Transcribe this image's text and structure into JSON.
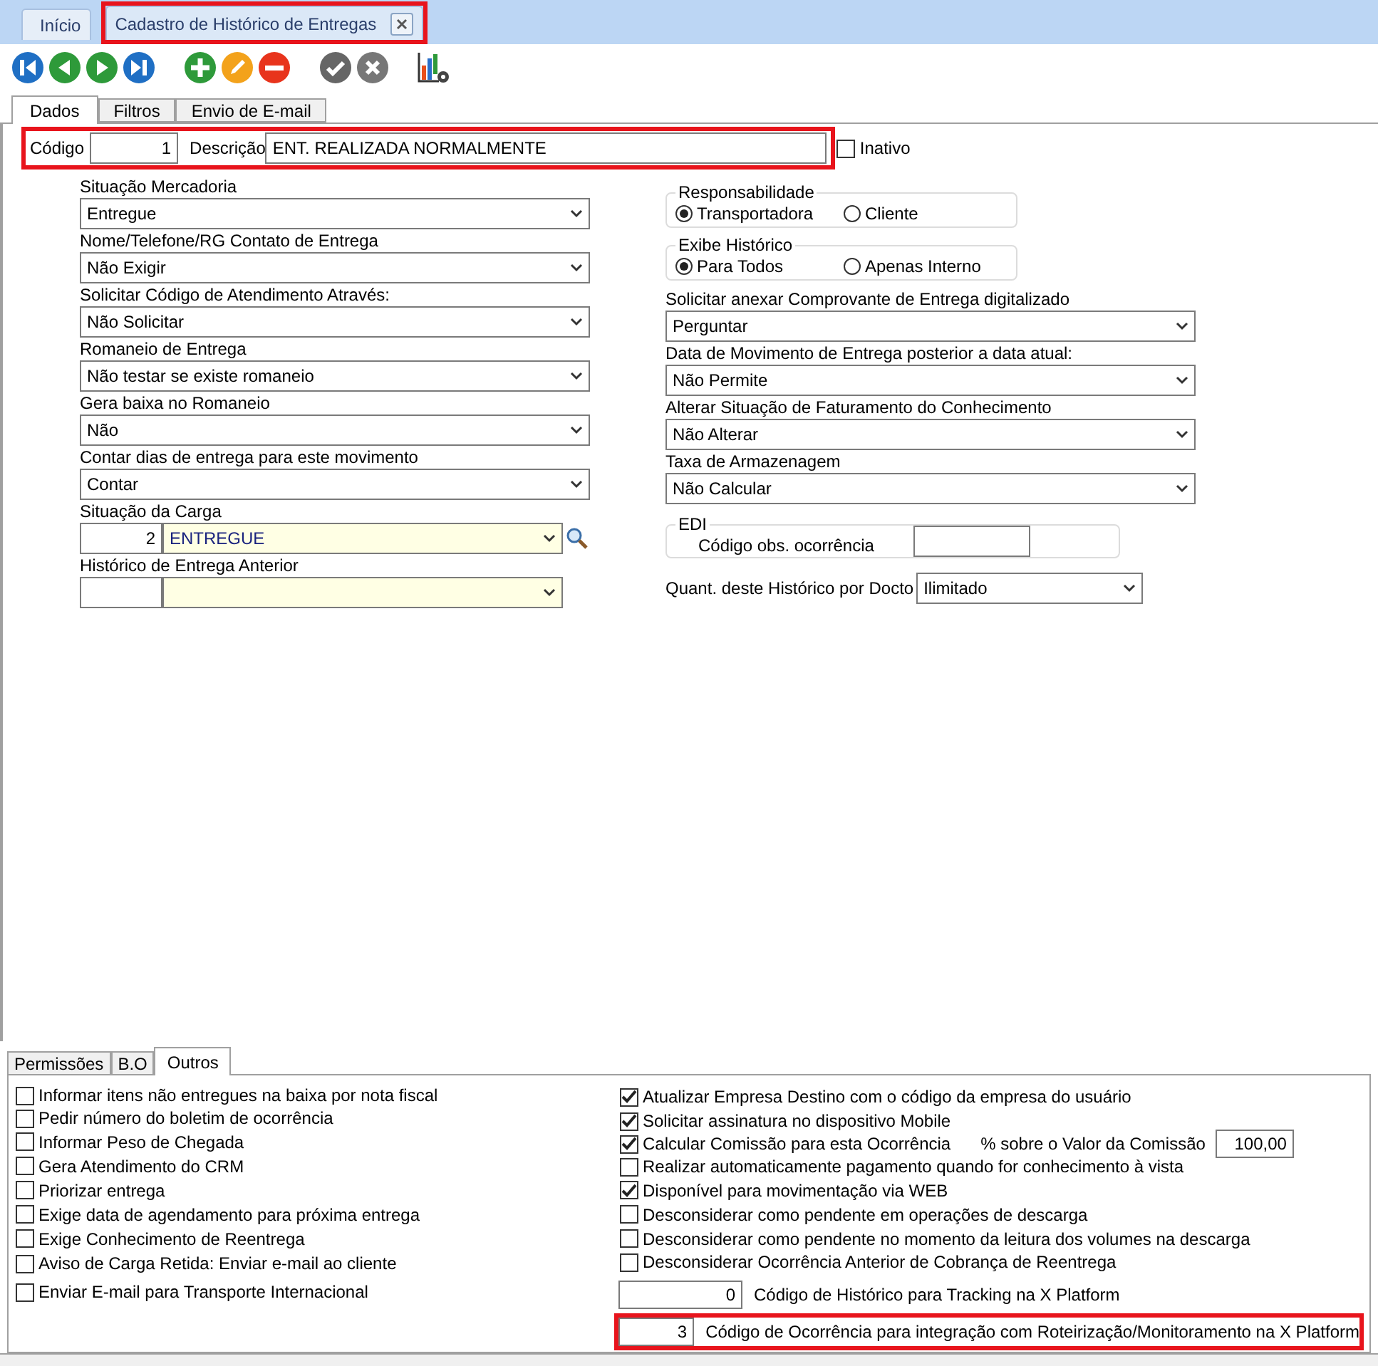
{
  "app_tabs": [
    {
      "label": "Início",
      "selected": false,
      "closable": false,
      "highlighted": false
    },
    {
      "label": "Cadastro de Histórico de Entregas",
      "selected": true,
      "closable": true,
      "highlighted": true
    }
  ],
  "toolbar": [
    {
      "kind": "first"
    },
    {
      "kind": "prev"
    },
    {
      "kind": "next"
    },
    {
      "kind": "last"
    },
    {
      "kind": "add"
    },
    {
      "kind": "edit"
    },
    {
      "kind": "delete"
    },
    {
      "kind": "confirm"
    },
    {
      "kind": "cancel"
    },
    {
      "kind": "report"
    }
  ],
  "form_tabs": [
    {
      "label": "Dados",
      "selected": true
    },
    {
      "label": "Filtros",
      "selected": false
    },
    {
      "label": "Envio de E-mail",
      "selected": false
    }
  ],
  "header": {
    "highlighted": true,
    "code_label": "Código",
    "code": "1",
    "description_label": "Descrição",
    "description": "ENT. REALIZADA NORMALMENTE",
    "inactive_label": "Inativo",
    "inactive": false
  },
  "left_fields": [
    {
      "kind": "select",
      "label": "Situação Mercadoria",
      "value": "Entregue"
    },
    {
      "kind": "select",
      "label": "Nome/Telefone/RG Contato de Entrega",
      "value": "Não Exigir"
    },
    {
      "kind": "select",
      "label": "Solicitar Código de Atendimento Através:",
      "value": "Não Solicitar"
    },
    {
      "kind": "select",
      "label": "Romaneio de Entrega",
      "value": "Não testar se existe romaneio"
    },
    {
      "kind": "select",
      "label": "Gera baixa no Romaneio",
      "value": "Não"
    },
    {
      "kind": "select",
      "label": "Contar dias de entrega para este movimento",
      "value": "Contar"
    },
    {
      "kind": "lookup",
      "label": "Situação da Carga",
      "code": "2",
      "value": "ENTREGUE",
      "search": true
    },
    {
      "kind": "lookup",
      "label": "Histórico de Entrega Anterior"
    }
  ],
  "radio_groups": [
    {
      "title": "Responsabilidade",
      "options": [
        {
          "label": "Transportadora",
          "selected": true
        },
        {
          "label": "Cliente",
          "selected": false
        }
      ]
    },
    {
      "title": "Exibe Histórico",
      "options": [
        {
          "label": "Para Todos",
          "selected": true
        },
        {
          "label": "Apenas Interno",
          "selected": false
        }
      ]
    }
  ],
  "right_fields": [
    {
      "label": "Solicitar anexar Comprovante de Entrega digitalizado",
      "value": "Perguntar"
    },
    {
      "label": "Data de Movimento de Entrega posterior a data atual:",
      "value": "Não Permite"
    },
    {
      "label": "Alterar Situação de Faturamento do Conhecimento",
      "value": "Não Alterar"
    },
    {
      "label": "Taxa de Armazenagem",
      "value": "Não Calcular"
    }
  ],
  "edi": {
    "title": "EDI",
    "label": "Código obs. ocorrência"
  },
  "quantity": {
    "label": "Quant. deste Histórico por Docto",
    "value": "Ilimitado"
  },
  "bottom_tabs": [
    {
      "label": "Permissões",
      "selected": false
    },
    {
      "label": "B.O",
      "selected": false
    },
    {
      "label": "Outros",
      "selected": true
    }
  ],
  "left_checks": [
    {
      "label": "Informar itens não entregues na baixa por nota fiscal",
      "checked": false
    },
    {
      "label": "Pedir número do boletim de ocorrência",
      "checked": false
    },
    {
      "label": "Informar Peso de Chegada",
      "checked": false
    },
    {
      "label": "Gera Atendimento do CRM",
      "checked": false
    },
    {
      "label": "Priorizar entrega",
      "checked": false
    },
    {
      "label": "Exige data de agendamento para próxima entrega",
      "checked": false
    },
    {
      "label": "Exige Conhecimento de Reentrega",
      "checked": false
    },
    {
      "label": "Aviso de Carga Retida: Enviar e-mail ao cliente",
      "checked": false
    },
    {
      "label": "Enviar E-mail para Transporte Internacional",
      "checked": false
    }
  ],
  "right_checks": [
    {
      "label": "Atualizar Empresa Destino com o código da empresa do usuário",
      "checked": true
    },
    {
      "label": "Solicitar assinatura no dispositivo Mobile",
      "checked": true
    },
    {
      "label": "Calcular Comissão para esta Ocorrência",
      "checked": true,
      "extra_label": "% sobre o Valor da Comissão",
      "extra_value": "100,00"
    },
    {
      "label": "Realizar automaticamente pagamento quando for conhecimento à vista",
      "checked": false
    },
    {
      "label": "Disponível para movimentação via WEB",
      "checked": true
    },
    {
      "label": "Desconsiderar como pendente em operações de descarga",
      "checked": false
    },
    {
      "label": "Desconsiderar como pendente no momento da leitura dos volumes na descarga",
      "checked": false
    },
    {
      "label": "Desconsiderar Ocorrência Anterior de Cobrança de Reentrega",
      "checked": false
    }
  ],
  "codes": [
    {
      "value": "0",
      "label": "Código de Histórico para Tracking na X Platform",
      "highlighted": false
    },
    {
      "value": "3",
      "label": "Código de Ocorrência para integração com Roteirização/Monitoramento na X Platform",
      "highlighted": true
    }
  ]
}
